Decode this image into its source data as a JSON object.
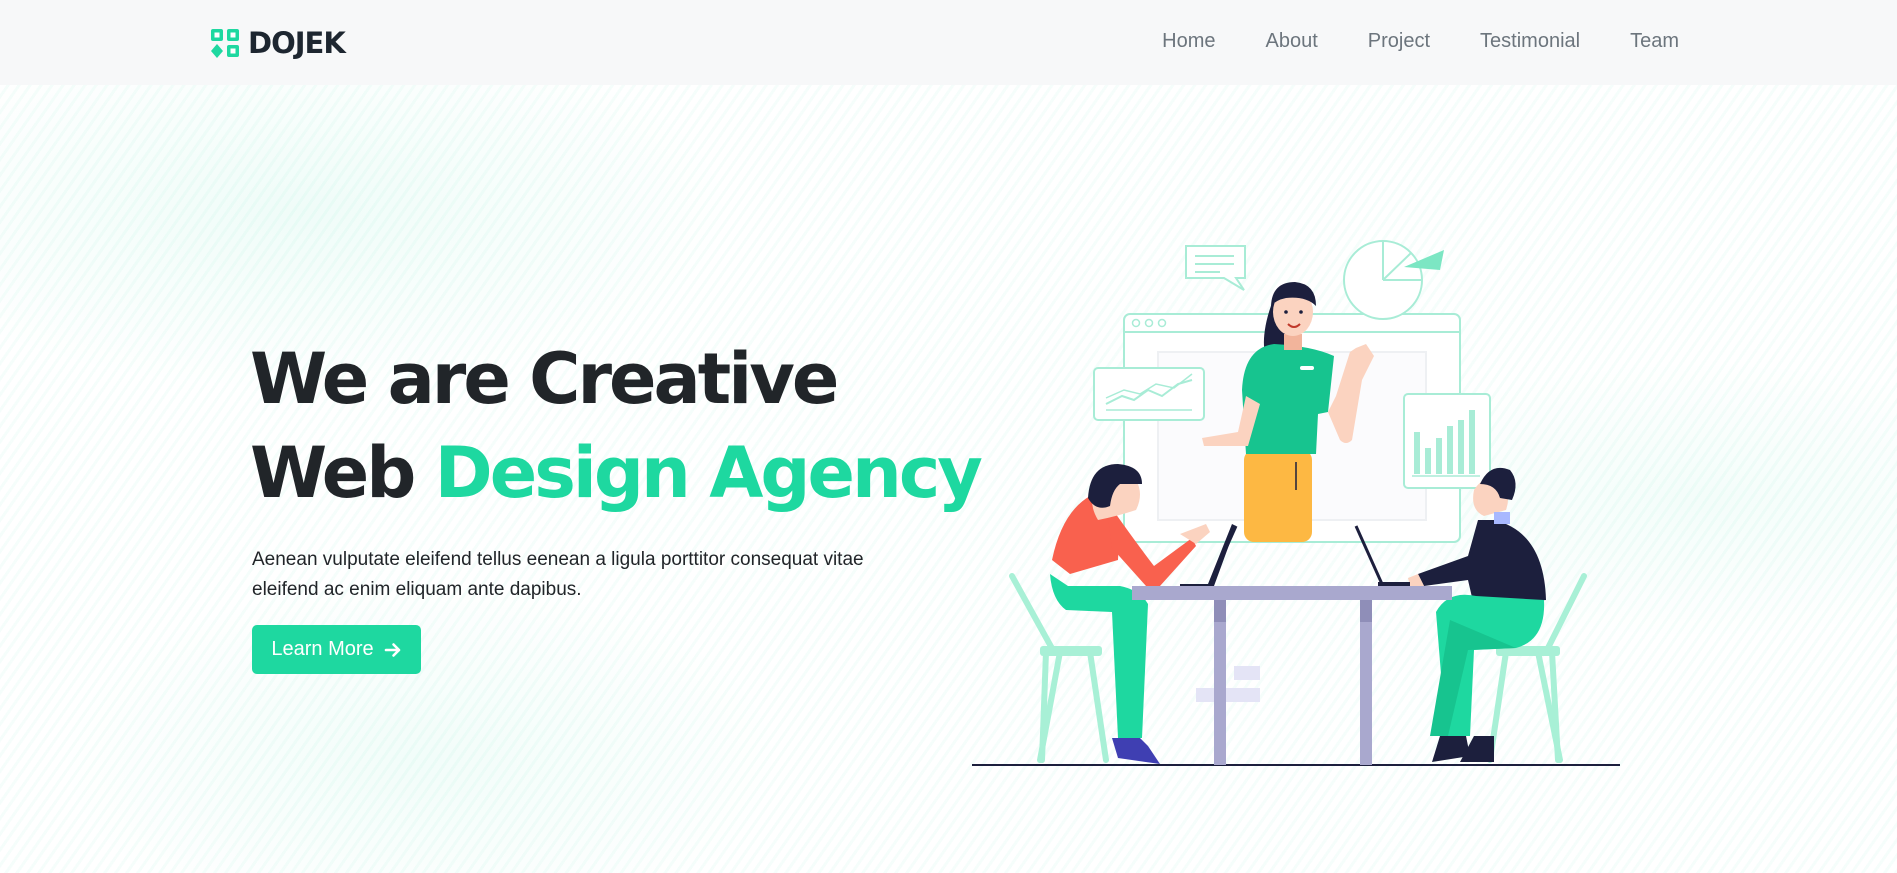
{
  "brand": {
    "name": "DOJEK",
    "icon": "logo-grid-icon"
  },
  "nav": {
    "items": [
      "Home",
      "About",
      "Project",
      "Testimonial",
      "Team"
    ]
  },
  "hero": {
    "title_line1": "We are Creative",
    "title_line2_plain": "Web ",
    "title_line2_accent": "Design Agency",
    "description": "Aenean vulputate eleifend tellus eenean a ligula porttitor consequat vitae eleifend ac enim eliquam ante dapibus.",
    "button_label": "Learn More",
    "button_icon": "arrow-right-icon"
  },
  "colors": {
    "accent": "#1ed8a0",
    "heading": "#212529",
    "nav_text": "#6c757d",
    "navbar_bg": "#f7f8f9"
  }
}
